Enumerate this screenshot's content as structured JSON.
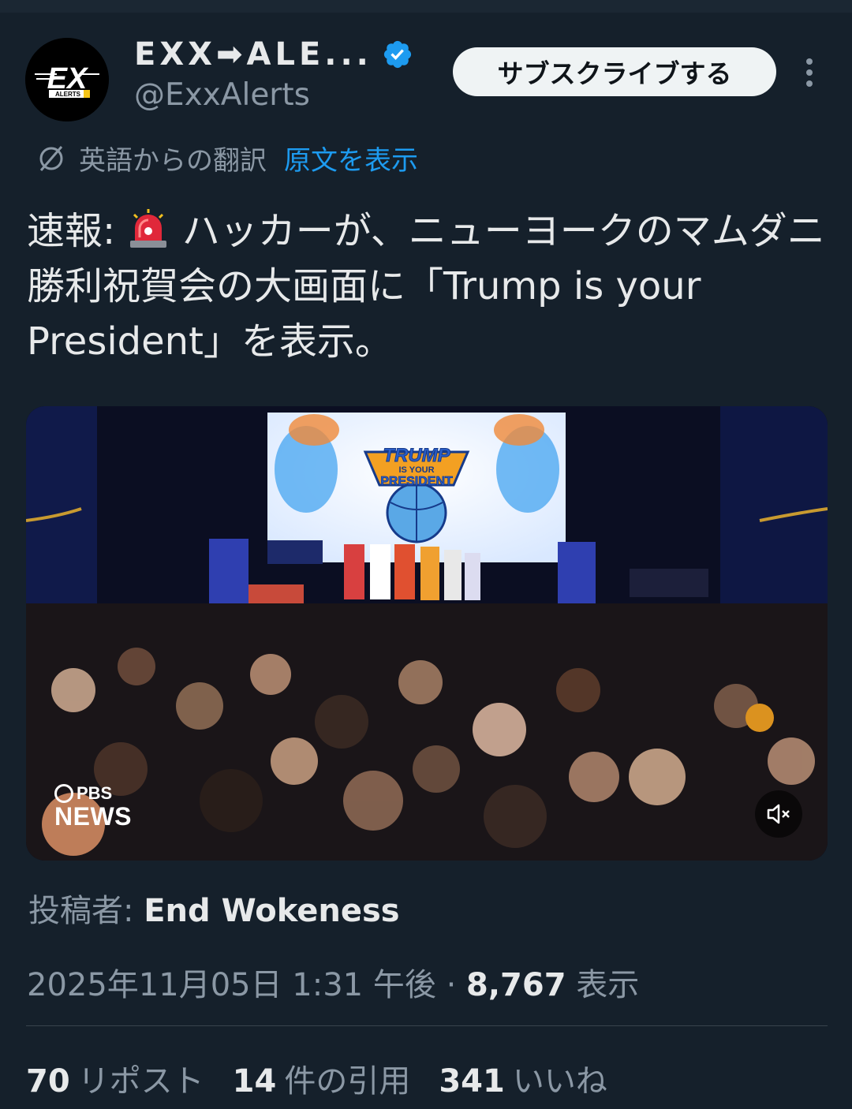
{
  "account": {
    "display_name": "EXX➡ALE...",
    "handle": "@ExxAlerts",
    "verified": true,
    "avatar_text": "EX",
    "avatar_subtext": "ALERTS",
    "avatar_icon": "exx-alerts-logo"
  },
  "actions": {
    "subscribe_label": "サブスクライブする",
    "more_icon": "more-vertical-icon"
  },
  "translation": {
    "icon": "translate-globe-icon",
    "label": "英語からの翻訳",
    "show_original": "原文を表示"
  },
  "tweet": {
    "prefix": "速報:",
    "emoji": "rotating-light-emoji",
    "body": "ハッカーが、ニューヨークのマムダニ勝利祝賀会の大画面に「Trump is your President」を表示。"
  },
  "media": {
    "screen_line1": "TRUMP",
    "screen_line2": "IS YOUR",
    "screen_line3": "PRESIDENT",
    "watermark_top": "PBS",
    "watermark_bottom": "NEWS",
    "mute_icon": "volume-mute-icon"
  },
  "attribution": {
    "label": "投稿者:",
    "name": "End Wokeness"
  },
  "meta": {
    "timestamp": "2025年11月05日 1:31 午後",
    "separator": "·",
    "views_count": "8,767",
    "views_label": "表示"
  },
  "stats": {
    "reposts_count": "70",
    "reposts_label": "リポスト",
    "quotes_count": "14",
    "quotes_label": "件の引用",
    "likes_count": "341",
    "likes_label": "いいね"
  },
  "colors": {
    "background": "#15202b",
    "accent_blue": "#1d9bf0",
    "secondary_text": "#8b98a5",
    "button_bg": "#eff3f4"
  }
}
